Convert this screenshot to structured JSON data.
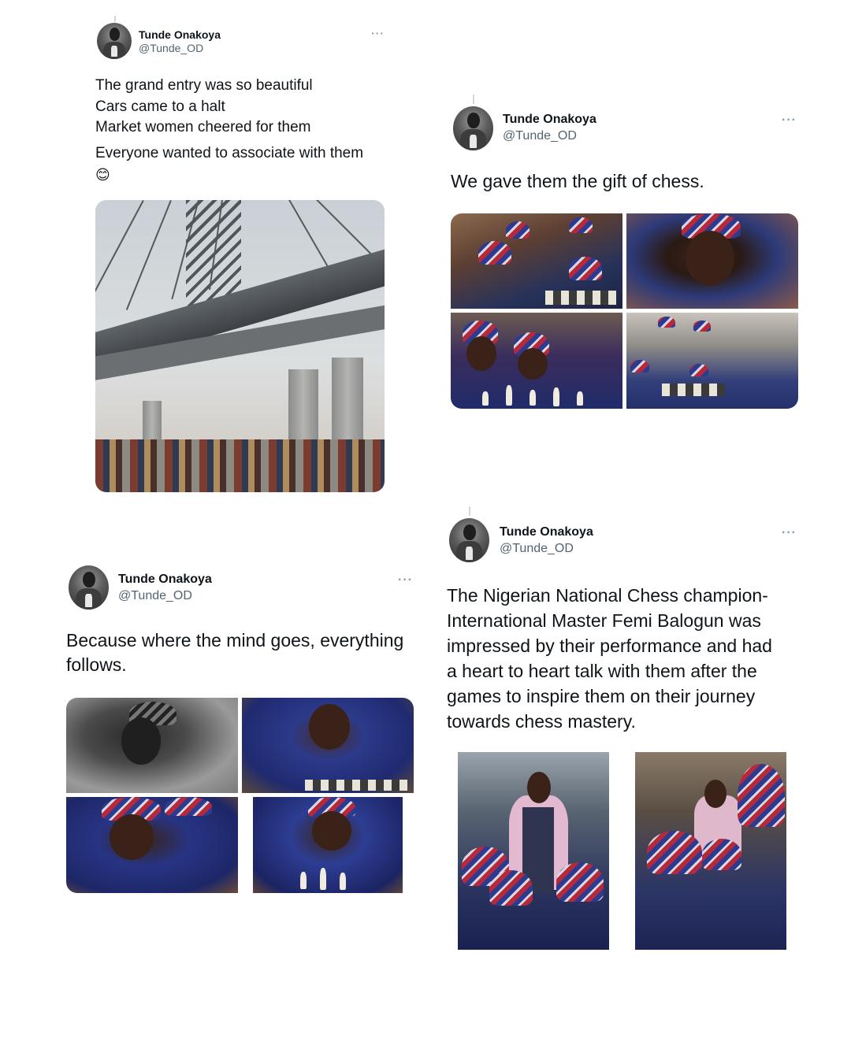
{
  "tweets": [
    {
      "name": "Tunde Onakoya",
      "handle": "@Tunde_OD",
      "more": "···",
      "lines": [
        "The grand entry was so beautiful",
        "Cars came to a halt",
        "Market women cheered for them"
      ],
      "line2": "Everyone wanted to associate with them",
      "emoji": "😊"
    },
    {
      "name": "Tunde Onakoya",
      "handle": "@Tunde_OD",
      "more": "···",
      "lines": [
        "We gave them the gift of chess."
      ]
    },
    {
      "name": "Tunde Onakoya",
      "handle": "@Tunde_OD",
      "more": "···",
      "lines": [
        "Because where the mind goes, everything",
        "follows."
      ]
    },
    {
      "name": "Tunde Onakoya",
      "handle": "@Tunde_OD",
      "more": "···",
      "lines": [
        "The Nigerian National Chess champion-",
        "International Master Femi Balogun was",
        "impressed by their performance and had",
        "a heart to heart talk with them after the",
        "games to inspire them on their journey",
        "towards chess mastery."
      ]
    }
  ],
  "colors": {
    "text": "#0f1419",
    "secondary": "#536471",
    "more": "#8899a6",
    "thread": "#cfd9de"
  },
  "icons": {
    "more": "more-horizontal-icon",
    "avatar": "profile-avatar"
  }
}
